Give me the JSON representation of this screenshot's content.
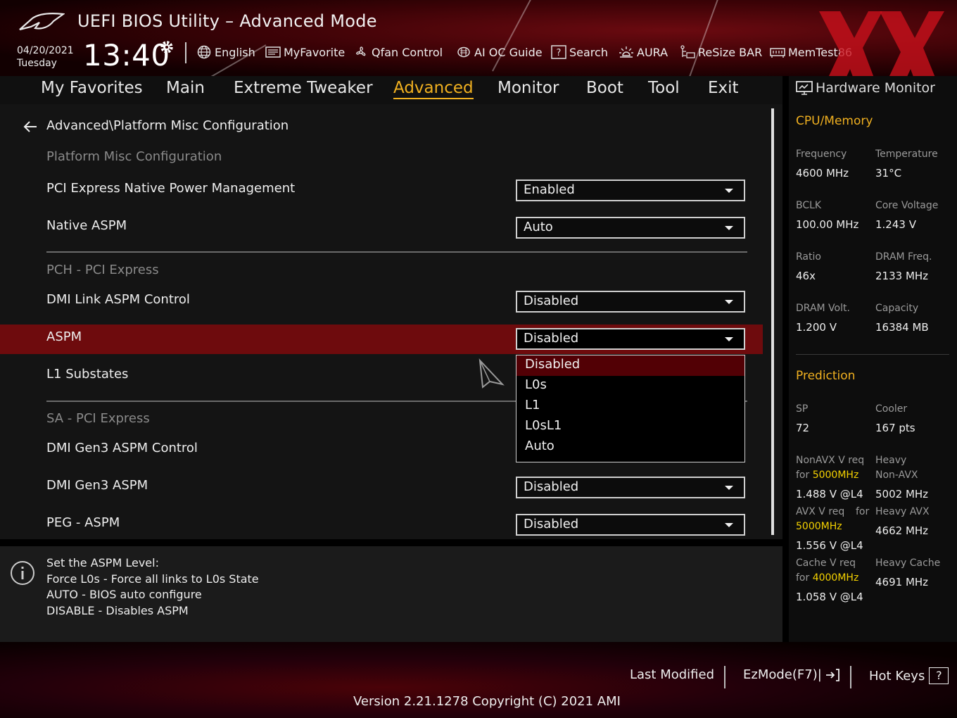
{
  "header": {
    "title": "UEFI BIOS Utility – Advanced Mode",
    "date": "04/20/2021",
    "day": "Tuesday",
    "time": "13:40",
    "toolbar": {
      "english": "English",
      "myfavorite": "MyFavorite",
      "qfan": "Qfan Control",
      "aioc": "AI OC Guide",
      "search": "Search",
      "aura": "AURA",
      "resizebar": "ReSize BAR",
      "memtest": "MemTest86"
    }
  },
  "tabs": {
    "favorites": "My Favorites",
    "main": "Main",
    "extreme": "Extreme Tweaker",
    "advanced": "Advanced",
    "monitor": "Monitor",
    "boot": "Boot",
    "tool": "Tool",
    "exit": "Exit"
  },
  "main": {
    "breadcrumb": "Advanced\\Platform Misc Configuration",
    "section_platform": "Platform Misc Configuration",
    "pcie_native_pm": {
      "label": "PCI Express Native Power Management",
      "value": "Enabled"
    },
    "native_aspm": {
      "label": "Native ASPM",
      "value": "Auto"
    },
    "section_pch": "PCH - PCI Express",
    "dmi_link_aspm": {
      "label": "DMI Link ASPM Control",
      "value": "Disabled"
    },
    "aspm": {
      "label": "ASPM",
      "value": "Disabled"
    },
    "l1_substates": {
      "label": "L1 Substates"
    },
    "section_sa": "SA - PCI Express",
    "dmi_gen3_aspm_control": {
      "label": "DMI Gen3 ASPM Control"
    },
    "dmi_gen3_aspm": {
      "label": "DMI Gen3 ASPM",
      "value": "Disabled"
    },
    "peg_aspm": {
      "label": "PEG - ASPM",
      "value": "Disabled"
    },
    "aspm_options": [
      "Disabled",
      "L0s",
      "L1",
      "L0sL1",
      "Auto"
    ]
  },
  "help": {
    "lines": [
      "Set the ASPM Level:",
      "Force L0s - Force all links to L0s State",
      "AUTO - BIOS auto configure",
      "DISABLE - Disables ASPM"
    ]
  },
  "hw_monitor": {
    "title": "Hardware Monitor",
    "cpu_mem_heading": "CPU/Memory",
    "frequency_label": "Frequency",
    "frequency": "4600 MHz",
    "temperature_label": "Temperature",
    "temperature": "31°C",
    "bclk_label": "BCLK",
    "bclk": "100.00 MHz",
    "core_voltage_label": "Core Voltage",
    "core_voltage": "1.243 V",
    "ratio_label": "Ratio",
    "ratio": "46x",
    "dram_freq_label": "DRAM Freq.",
    "dram_freq": "2133 MHz",
    "dram_volt_label": "DRAM Volt.",
    "dram_volt": "1.200 V",
    "capacity_label": "Capacity",
    "capacity": "16384 MB",
    "prediction_heading": "Prediction",
    "sp_label": "SP",
    "sp": "72",
    "cooler_label": "Cooler",
    "cooler": "167 pts",
    "nonavx_req_label": "NonAVX V req",
    "for_label": "for",
    "nonavx_freq": "5000MHz",
    "nonavx_v": "1.488 V @L4",
    "heavy_label": "Heavy",
    "nonavx_label": "Non-AVX",
    "heavy_nonavx": "5002 MHz",
    "avx_req_label": "AVX V req",
    "avx_freq": "5000MHz",
    "avx_v": "1.556 V @L4",
    "heavy_avx_label": "Heavy AVX",
    "heavy_avx": "4662 MHz",
    "cache_req_label": "Cache V req",
    "cache_freq": "4000MHz",
    "cache_v": "1.058 V @L4",
    "heavy_cache_label": "Heavy Cache",
    "heavy_cache": "4691 MHz"
  },
  "footer": {
    "last_modified": "Last Modified",
    "ezmode": "EzMode(F7)|",
    "hotkeys": "Hot Keys",
    "hotkeys_icon": "?",
    "version": "Version 2.21.1278 Copyright (C) 2021 AMI"
  },
  "colors": {
    "accent": "#f0b020",
    "highlight_row": "#6e0b0d",
    "dropdown_highlight": "#520005",
    "prediction_value": "#f5d200"
  }
}
